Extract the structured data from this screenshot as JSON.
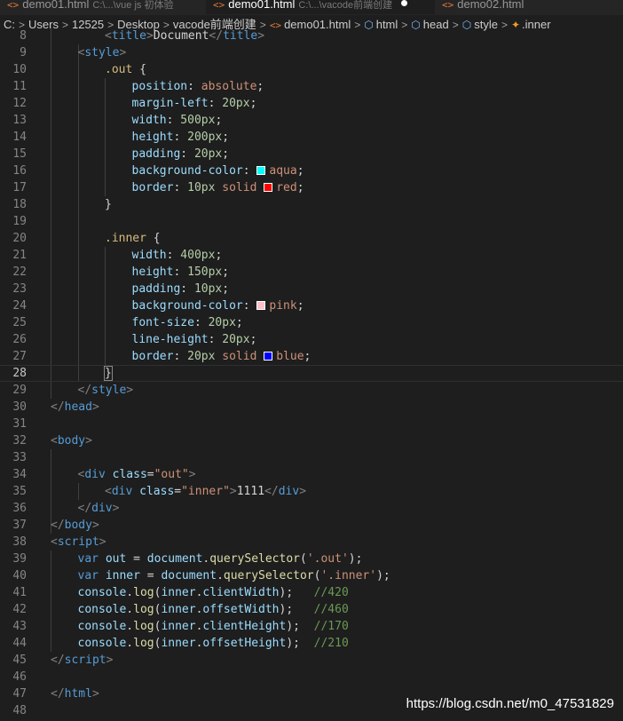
{
  "tabs": [
    {
      "name": "demo01.html",
      "desc": "C:\\...\\vue js 初体验"
    },
    {
      "name": "demo01.html",
      "desc": "C:\\...\\vacode前端创建"
    },
    {
      "name": "demo02.html",
      "desc": ""
    }
  ],
  "tab_icon": "<>",
  "breadcrumb": [
    "C:",
    "Users",
    "12525",
    "Desktop",
    "vacode前端创建",
    "demo01.html",
    "html",
    "head",
    "style",
    ".inner"
  ],
  "breadcrumb_icons": {
    "file": "<>",
    "element": "⬡",
    "style": "✦"
  },
  "separator": ">",
  "colors": {
    "aqua": "#00ffff",
    "red": "#ff0000",
    "pink": "#ffc0cb",
    "blue": "#0000ff"
  },
  "lines": [
    {
      "n": "8",
      "t": [
        [
          "t-br",
          "<"
        ],
        [
          "t-tag",
          "title"
        ],
        [
          "t-br",
          ">"
        ],
        [
          "t-txt",
          "Document"
        ],
        [
          "t-br",
          "</"
        ],
        [
          "t-tag",
          "title"
        ],
        [
          "t-br",
          ">"
        ]
      ]
    },
    {
      "n": "9",
      "t": [
        [
          "t-br",
          "<"
        ],
        [
          "t-tag",
          "style"
        ],
        [
          "t-br",
          ">"
        ]
      ]
    },
    {
      "n": "10",
      "t": [
        [
          "t-sel",
          ".out"
        ],
        [
          "t-txt",
          " {"
        ]
      ]
    },
    {
      "n": "11",
      "t": [
        [
          "t-prop",
          "position"
        ],
        [
          "t-txt",
          ": "
        ],
        [
          "t-val",
          "absolute"
        ],
        [
          "t-txt",
          ";"
        ]
      ]
    },
    {
      "n": "12",
      "t": [
        [
          "t-prop",
          "margin-left"
        ],
        [
          "t-txt",
          ": "
        ],
        [
          "t-num",
          "20px"
        ],
        [
          "t-txt",
          ";"
        ]
      ]
    },
    {
      "n": "13",
      "t": [
        [
          "t-prop",
          "width"
        ],
        [
          "t-txt",
          ": "
        ],
        [
          "t-num",
          "500px"
        ],
        [
          "t-txt",
          ";"
        ]
      ]
    },
    {
      "n": "14",
      "t": [
        [
          "t-prop",
          "height"
        ],
        [
          "t-txt",
          ": "
        ],
        [
          "t-num",
          "200px"
        ],
        [
          "t-txt",
          ";"
        ]
      ]
    },
    {
      "n": "15",
      "t": [
        [
          "t-prop",
          "padding"
        ],
        [
          "t-txt",
          ": "
        ],
        [
          "t-num",
          "20px"
        ],
        [
          "t-txt",
          ";"
        ]
      ]
    },
    {
      "n": "16",
      "t": [
        [
          "t-prop",
          "background-color"
        ],
        [
          "t-txt",
          ": "
        ],
        [
          "swatch",
          "aqua"
        ],
        [
          "t-val",
          "aqua"
        ],
        [
          "t-txt",
          ";"
        ]
      ]
    },
    {
      "n": "17",
      "t": [
        [
          "t-prop",
          "border"
        ],
        [
          "t-txt",
          ": "
        ],
        [
          "t-num",
          "10px"
        ],
        [
          "t-txt",
          " "
        ],
        [
          "t-val",
          "solid"
        ],
        [
          "t-txt",
          " "
        ],
        [
          "swatch",
          "red"
        ],
        [
          "t-val",
          "red"
        ],
        [
          "t-txt",
          ";"
        ]
      ]
    },
    {
      "n": "18",
      "t": [
        [
          "t-txt",
          "}"
        ]
      ]
    },
    {
      "n": "19",
      "t": []
    },
    {
      "n": "20",
      "t": [
        [
          "t-sel",
          ".inner"
        ],
        [
          "t-txt",
          " "
        ],
        [
          "t-txt",
          "{"
        ]
      ]
    },
    {
      "n": "21",
      "t": [
        [
          "t-prop",
          "width"
        ],
        [
          "t-txt",
          ": "
        ],
        [
          "t-num",
          "400px"
        ],
        [
          "t-txt",
          ";"
        ]
      ]
    },
    {
      "n": "22",
      "t": [
        [
          "t-prop",
          "height"
        ],
        [
          "t-txt",
          ": "
        ],
        [
          "t-num",
          "150px"
        ],
        [
          "t-txt",
          ";"
        ]
      ]
    },
    {
      "n": "23",
      "t": [
        [
          "t-prop",
          "padding"
        ],
        [
          "t-txt",
          ": "
        ],
        [
          "t-num",
          "10px"
        ],
        [
          "t-txt",
          ";"
        ]
      ]
    },
    {
      "n": "24",
      "t": [
        [
          "t-prop",
          "background-color"
        ],
        [
          "t-txt",
          ": "
        ],
        [
          "swatch",
          "pink"
        ],
        [
          "t-val",
          "pink"
        ],
        [
          "t-txt",
          ";"
        ]
      ]
    },
    {
      "n": "25",
      "t": [
        [
          "t-prop",
          "font-size"
        ],
        [
          "t-txt",
          ": "
        ],
        [
          "t-num",
          "20px"
        ],
        [
          "t-txt",
          ";"
        ]
      ]
    },
    {
      "n": "26",
      "t": [
        [
          "t-prop",
          "line-height"
        ],
        [
          "t-txt",
          ": "
        ],
        [
          "t-num",
          "20px"
        ],
        [
          "t-txt",
          ";"
        ]
      ]
    },
    {
      "n": "27",
      "t": [
        [
          "t-prop",
          "border"
        ],
        [
          "t-txt",
          ": "
        ],
        [
          "t-num",
          "20px"
        ],
        [
          "t-txt",
          " "
        ],
        [
          "t-val",
          "solid"
        ],
        [
          "t-txt",
          " "
        ],
        [
          "swatch",
          "blue"
        ],
        [
          "t-val",
          "blue"
        ],
        [
          "t-txt",
          ";"
        ]
      ]
    },
    {
      "n": "28",
      "t": [
        [
          "t-txt",
          "}"
        ]
      ],
      "current": true
    },
    {
      "n": "29",
      "t": [
        [
          "t-br",
          "</"
        ],
        [
          "t-tag",
          "style"
        ],
        [
          "t-br",
          ">"
        ]
      ]
    },
    {
      "n": "30",
      "t": [
        [
          "t-br",
          "</"
        ],
        [
          "t-tag",
          "head"
        ],
        [
          "t-br",
          ">"
        ]
      ]
    },
    {
      "n": "31",
      "t": []
    },
    {
      "n": "32",
      "t": [
        [
          "t-br",
          "<"
        ],
        [
          "t-tag",
          "body"
        ],
        [
          "t-br",
          ">"
        ]
      ]
    },
    {
      "n": "33",
      "t": []
    },
    {
      "n": "34",
      "t": [
        [
          "t-br",
          "<"
        ],
        [
          "t-tag",
          "div"
        ],
        [
          "t-txt",
          " "
        ],
        [
          "t-attr",
          "class"
        ],
        [
          "t-txt",
          "="
        ],
        [
          "t-str",
          "\"out\""
        ],
        [
          "t-br",
          ">"
        ]
      ]
    },
    {
      "n": "35",
      "t": [
        [
          "t-br",
          "<"
        ],
        [
          "t-tag",
          "div"
        ],
        [
          "t-txt",
          " "
        ],
        [
          "t-attr",
          "class"
        ],
        [
          "t-txt",
          "="
        ],
        [
          "t-str",
          "\"inner\""
        ],
        [
          "t-br",
          ">"
        ],
        [
          "t-txt",
          "1111"
        ],
        [
          "t-br",
          "</"
        ],
        [
          "t-tag",
          "div"
        ],
        [
          "t-br",
          ">"
        ]
      ]
    },
    {
      "n": "36",
      "t": [
        [
          "t-br",
          "</"
        ],
        [
          "t-tag",
          "div"
        ],
        [
          "t-br",
          ">"
        ]
      ]
    },
    {
      "n": "37",
      "t": [
        [
          "t-br",
          "</"
        ],
        [
          "t-tag",
          "body"
        ],
        [
          "t-br",
          ">"
        ]
      ]
    },
    {
      "n": "38",
      "t": [
        [
          "t-br",
          "<"
        ],
        [
          "t-tag",
          "script"
        ],
        [
          "t-br",
          ">"
        ]
      ]
    },
    {
      "n": "39",
      "t": [
        [
          "t-kw",
          "var"
        ],
        [
          "t-txt",
          " "
        ],
        [
          "t-var",
          "out"
        ],
        [
          "t-txt",
          " = "
        ],
        [
          "t-var",
          "document"
        ],
        [
          "t-txt",
          "."
        ],
        [
          "t-fn",
          "querySelector"
        ],
        [
          "t-txt",
          "("
        ],
        [
          "t-str",
          "'.out'"
        ],
        [
          "t-txt",
          ");"
        ]
      ]
    },
    {
      "n": "40",
      "t": [
        [
          "t-kw",
          "var"
        ],
        [
          "t-txt",
          " "
        ],
        [
          "t-var",
          "inner"
        ],
        [
          "t-txt",
          " = "
        ],
        [
          "t-var",
          "document"
        ],
        [
          "t-txt",
          "."
        ],
        [
          "t-fn",
          "querySelector"
        ],
        [
          "t-txt",
          "("
        ],
        [
          "t-str",
          "'.inner'"
        ],
        [
          "t-txt",
          ");"
        ]
      ]
    },
    {
      "n": "41",
      "t": [
        [
          "t-var",
          "console"
        ],
        [
          "t-txt",
          "."
        ],
        [
          "t-fn",
          "log"
        ],
        [
          "t-txt",
          "("
        ],
        [
          "t-var",
          "inner"
        ],
        [
          "t-txt",
          "."
        ],
        [
          "t-var",
          "clientWidth"
        ],
        [
          "t-txt",
          ");   "
        ],
        [
          "t-com",
          "//420"
        ]
      ]
    },
    {
      "n": "42",
      "t": [
        [
          "t-var",
          "console"
        ],
        [
          "t-txt",
          "."
        ],
        [
          "t-fn",
          "log"
        ],
        [
          "t-txt",
          "("
        ],
        [
          "t-var",
          "inner"
        ],
        [
          "t-txt",
          "."
        ],
        [
          "t-var",
          "offsetWidth"
        ],
        [
          "t-txt",
          ");   "
        ],
        [
          "t-com",
          "//460"
        ]
      ]
    },
    {
      "n": "43",
      "t": [
        [
          "t-var",
          "console"
        ],
        [
          "t-txt",
          "."
        ],
        [
          "t-fn",
          "log"
        ],
        [
          "t-txt",
          "("
        ],
        [
          "t-var",
          "inner"
        ],
        [
          "t-txt",
          "."
        ],
        [
          "t-var",
          "clientHeight"
        ],
        [
          "t-txt",
          ");  "
        ],
        [
          "t-com",
          "//170"
        ]
      ]
    },
    {
      "n": "44",
      "t": [
        [
          "t-var",
          "console"
        ],
        [
          "t-txt",
          "."
        ],
        [
          "t-fn",
          "log"
        ],
        [
          "t-txt",
          "("
        ],
        [
          "t-var",
          "inner"
        ],
        [
          "t-txt",
          "."
        ],
        [
          "t-var",
          "offsetHeight"
        ],
        [
          "t-txt",
          ");  "
        ],
        [
          "t-com",
          "//210"
        ]
      ]
    },
    {
      "n": "45",
      "t": [
        [
          "t-br",
          "</"
        ],
        [
          "t-tag",
          "script"
        ],
        [
          "t-br",
          ">"
        ]
      ]
    },
    {
      "n": "46",
      "t": []
    },
    {
      "n": "47",
      "t": [
        [
          "t-br",
          "</"
        ],
        [
          "t-tag",
          "html"
        ],
        [
          "t-br",
          ">"
        ]
      ]
    },
    {
      "n": "48",
      "t": []
    }
  ],
  "watermark": "https://blog.csdn.net/m0_47531829"
}
